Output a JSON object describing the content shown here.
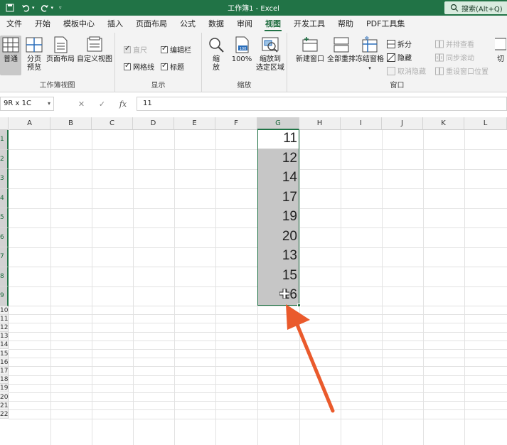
{
  "titlebar": {
    "title": "工作簿1 - Excel",
    "search_placeholder": "搜索(Alt+Q)"
  },
  "tabs": [
    "文件",
    "开始",
    "模板中心",
    "插入",
    "页面布局",
    "公式",
    "数据",
    "审阅",
    "视图",
    "开发工具",
    "帮助",
    "PDF工具集"
  ],
  "active_tab": "视图",
  "ribbon": {
    "workbook_views": {
      "label": "工作簿视图",
      "buttons": [
        "普通",
        "分页\n预览",
        "页面布局",
        "自定义视图"
      ]
    },
    "show": {
      "label": "显示",
      "ruler": "直尺",
      "formula_bar": "编辑栏",
      "gridlines": "网格线",
      "headings": "标题"
    },
    "zoom": {
      "label": "缩放",
      "zoom": "缩\n放",
      "zoom_100": "100%",
      "zoom_selection": "缩放到\n选定区域"
    },
    "window": {
      "label": "窗口",
      "new_window": "新建窗口",
      "arrange_all": "全部重排",
      "freeze_panes": "冻结窗格",
      "split": "拆分",
      "hide": "隐藏",
      "unhide": "取消隐藏",
      "side_by_side": "并排查看",
      "sync_scroll": "同步滚动",
      "reset_position": "重设窗口位置",
      "switch": "切"
    }
  },
  "formula_bar": {
    "name_box": "9R x 1C",
    "formula": "11",
    "fx": "fx"
  },
  "grid": {
    "columns": [
      "A",
      "B",
      "C",
      "D",
      "E",
      "F",
      "G",
      "H",
      "I",
      "J",
      "K",
      "L"
    ],
    "selected_column": "G",
    "rows": [
      "1",
      "2",
      "3",
      "4",
      "5",
      "6",
      "7",
      "8",
      "9",
      "10",
      "11",
      "12",
      "13",
      "14",
      "15",
      "16",
      "17",
      "18",
      "19",
      "20",
      "21",
      "22"
    ],
    "column_g_values": [
      "11",
      "12",
      "14",
      "17",
      "19",
      "20",
      "13",
      "15",
      "16"
    ]
  },
  "colors": {
    "excel_green": "#217346",
    "selection_fill": "#c6c6c6",
    "arrow": "#ea5a2c"
  }
}
